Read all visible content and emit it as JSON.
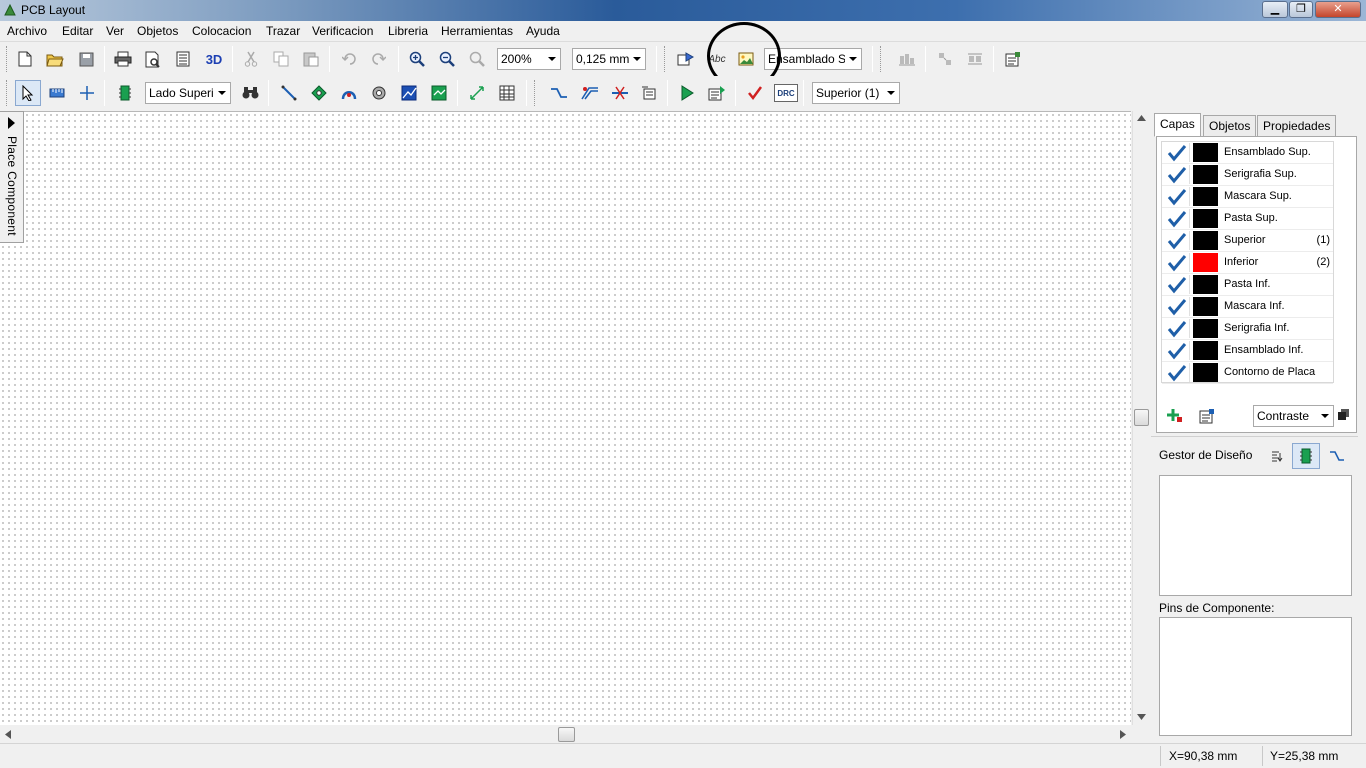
{
  "window": {
    "title": "PCB Layout",
    "minimize": "▁",
    "maximize": "❐",
    "close": "✕"
  },
  "menu": [
    {
      "label": "Archivo"
    },
    {
      "label": "Editar"
    },
    {
      "label": "Ver"
    },
    {
      "label": "Objetos"
    },
    {
      "label": "Colocacion"
    },
    {
      "label": "Trazar"
    },
    {
      "label": "Verificacion"
    },
    {
      "label": "Libreria"
    },
    {
      "label": "Herramientas"
    },
    {
      "label": "Ayuda"
    }
  ],
  "toolbar1": {
    "three_d_label": "3D",
    "zoom_value": "200%",
    "grid_value": "0,125 mm",
    "text_icon_label": "Abc",
    "layer_value": "Ensamblado Sup"
  },
  "toolbar2": {
    "side_value": "Lado Superio",
    "layer_value": "Superior (1)",
    "drc_label": "DRC"
  },
  "place_tab": {
    "label": "Place Component"
  },
  "panel": {
    "tabs": [
      {
        "label": "Capas"
      },
      {
        "label": "Objetos"
      },
      {
        "label": "Propiedades"
      }
    ],
    "active_tab": "Capas",
    "layers": [
      {
        "name": "Ensamblado Sup.",
        "number": "",
        "color": "#000000",
        "checked": true
      },
      {
        "name": "Serigrafia Sup.",
        "number": "",
        "color": "#000000",
        "checked": true
      },
      {
        "name": "Mascara Sup.",
        "number": "",
        "color": "#000000",
        "checked": true
      },
      {
        "name": "Pasta Sup.",
        "number": "",
        "color": "#000000",
        "checked": true
      },
      {
        "name": "Superior",
        "number": "(1)",
        "color": "#000000",
        "checked": true
      },
      {
        "name": "Inferior",
        "number": "(2)",
        "color": "#ff0000",
        "checked": true
      },
      {
        "name": "Pasta Inf.",
        "number": "",
        "color": "#000000",
        "checked": true
      },
      {
        "name": "Mascara Inf.",
        "number": "",
        "color": "#000000",
        "checked": true
      },
      {
        "name": "Serigrafia Inf.",
        "number": "",
        "color": "#000000",
        "checked": true
      },
      {
        "name": "Ensamblado Inf.",
        "number": "",
        "color": "#000000",
        "checked": true
      },
      {
        "name": "Contorno de Placa",
        "number": "",
        "color": "#000000",
        "checked": true
      }
    ],
    "contrast_value": "Contraste",
    "design_manager_title": "Gestor de Diseño",
    "component_pins_title": "Pins de Componente:"
  },
  "status": {
    "x_coord": "X=90,38 mm",
    "y_coord": "Y=25,38 mm"
  },
  "colors": {
    "accent_blue": "#1c5fb3",
    "check_blue": "#1f5fa8",
    "layer_red": "#ff0000"
  }
}
